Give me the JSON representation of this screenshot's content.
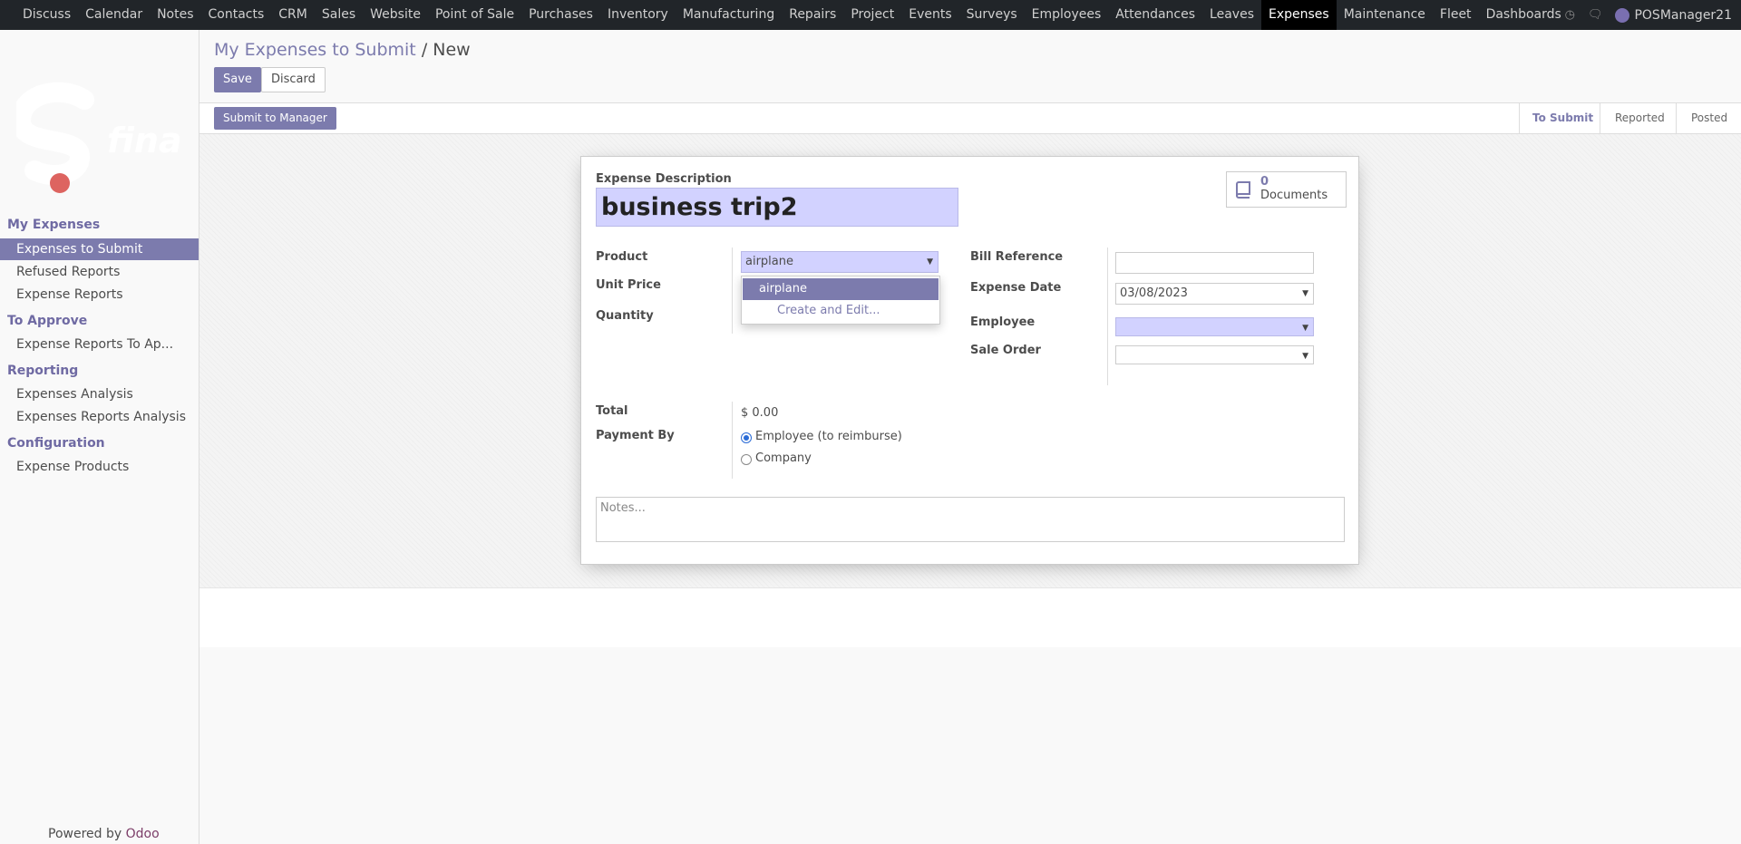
{
  "topnav": {
    "menu": [
      "Discuss",
      "Calendar",
      "Notes",
      "Contacts",
      "CRM",
      "Sales",
      "Website",
      "Point of Sale",
      "Purchases",
      "Inventory",
      "Manufacturing",
      "Repairs",
      "Project",
      "Events",
      "Surveys",
      "Employees",
      "Attendances",
      "Leaves",
      "Expenses",
      "Maintenance",
      "Fleet",
      "Dashboards"
    ],
    "active": "Expenses",
    "user": "POSManager21"
  },
  "sidebar": {
    "sections": [
      {
        "title": "My Expenses",
        "items": [
          "Expenses to Submit",
          "Refused Reports",
          "Expense Reports"
        ]
      },
      {
        "title": "To Approve",
        "items": [
          "Expense Reports To Ap..."
        ]
      },
      {
        "title": "Reporting",
        "items": [
          "Expenses Analysis",
          "Expenses Reports Analysis"
        ]
      },
      {
        "title": "Configuration",
        "items": [
          "Expense Products"
        ]
      }
    ],
    "active_item": "Expenses to Submit",
    "powered_by": "Powered by",
    "brand": "Odoo"
  },
  "breadcrumb": {
    "parent": "My Expenses to Submit",
    "separator": "/",
    "current": "New"
  },
  "buttons": {
    "save": "Save",
    "discard": "Discard",
    "submit": "Submit to Manager"
  },
  "status": {
    "stages": [
      "To Submit",
      "Reported",
      "Posted"
    ],
    "active": "To Submit"
  },
  "form": {
    "documents_count": "0",
    "documents_label": "Documents",
    "description_label": "Expense Description",
    "description_value": "business trip2",
    "product_label": "Product",
    "product_value": "airplane",
    "unit_price_label": "Unit Price",
    "quantity_label": "Quantity",
    "bill_ref_label": "Bill Reference",
    "bill_ref_value": "",
    "date_label": "Expense Date",
    "date_value": "03/08/2023",
    "employee_label": "Employee",
    "employee_value": "",
    "sale_order_label": "Sale Order",
    "sale_order_value": "",
    "total_label": "Total",
    "total_value": "$ 0.00",
    "payment_label": "Payment By",
    "payment_options": [
      "Employee (to reimburse)",
      "Company"
    ],
    "payment_selected": "Employee (to reimburse)",
    "notes_placeholder": "Notes..."
  },
  "product_dropdown": {
    "options": [
      "airplane"
    ],
    "create_label": "Create and Edit..."
  },
  "colors": {
    "accent": "#7c7bad",
    "required": "#d2d2ff",
    "topbar": "#212529"
  }
}
